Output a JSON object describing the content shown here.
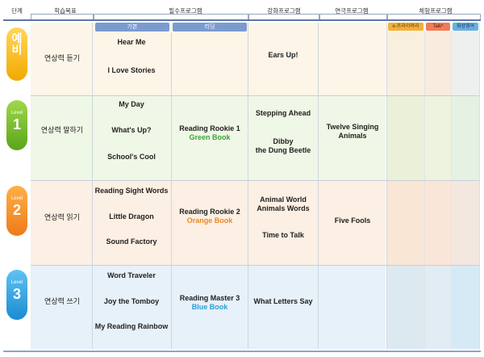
{
  "header": {
    "col_stage": "단계",
    "col_goal": "학습목표",
    "col_required": "필수프로그램",
    "col_intensive": "강화프로그램",
    "col_drama": "연극프로그램",
    "col_experience": "체험프로그램",
    "sub_basic": "기본",
    "sub_reading": "리딩",
    "sub_eprimary": "e-프라이머리",
    "sub_talk": "Talk*",
    "sub_video": "화상영어"
  },
  "levels": [
    {
      "badge_level": "",
      "badge_num": "예비",
      "goal": "연상력 듣기",
      "basic": [
        "Hear  Me",
        "I Love Stories"
      ],
      "reading_title": "",
      "reading_book": "",
      "intensive": [
        "Ears Up!"
      ],
      "drama": ""
    },
    {
      "badge_level": "Level",
      "badge_num": "1",
      "goal": "연상력 말하기",
      "basic": [
        "My Day",
        "What's Up?",
        "School's Cool"
      ],
      "reading_title": "Reading Rookie 1",
      "reading_book": "Green Book",
      "intensive": [
        "Stepping Ahead",
        "Dibby",
        "the Dung Beetle"
      ],
      "drama": "Twelve Singing\nAnimals"
    },
    {
      "badge_level": "Level",
      "badge_num": "2",
      "goal": "연상력 읽기",
      "basic": [
        "Reading Sight Words",
        "Little Dragon",
        "Sound Factory"
      ],
      "reading_title": "Reading Rookie 2",
      "reading_book": "Orange Book",
      "intensive": [
        "Animal World",
        "Animals Words",
        "Time to Talk"
      ],
      "drama": "Five Fools"
    },
    {
      "badge_level": "Level",
      "badge_num": "3",
      "goal": "연상력 쓰기",
      "basic": [
        "Word Traveler",
        "Joy the Tomboy",
        "My Reading Rainbow"
      ],
      "reading_title": "Reading Master 3",
      "reading_book": "Blue Book",
      "intensive": [
        "What Letters Say"
      ],
      "drama": ""
    }
  ],
  "colors": {
    "header_line": "#5b77a8",
    "basic_tab": "#7b9bd0",
    "reading_tab": "#7b9bd0",
    "eprimary_tab": "#f2b03a",
    "talk_tab": "#ef7c56",
    "video_tab": "#6ab0e0",
    "green_book": "#3aa53a",
    "orange_book": "#e8892a",
    "blue_book": "#2c9fd8"
  }
}
